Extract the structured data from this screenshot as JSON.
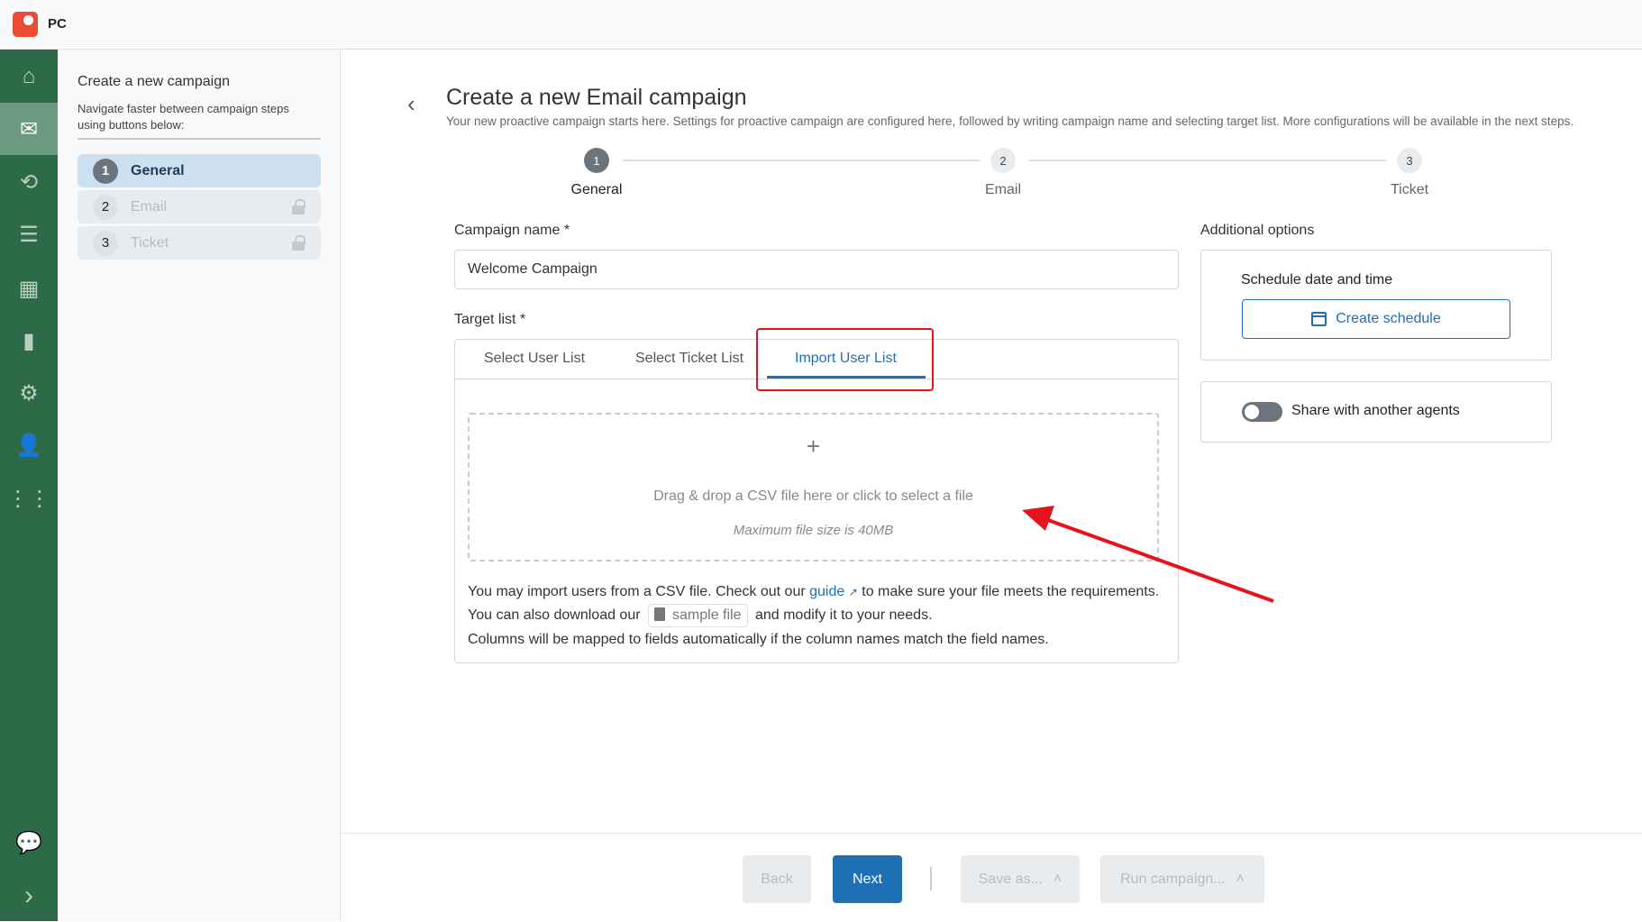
{
  "app": {
    "title": "PC"
  },
  "nav": {
    "items": [
      "home",
      "email",
      "integrations",
      "inbox",
      "widgets",
      "reports",
      "settings",
      "agents",
      "apps"
    ],
    "bottom": [
      "chat",
      "expand"
    ],
    "active": "email"
  },
  "panel": {
    "title": "Create a new campaign",
    "description": "Navigate faster between campaign steps using buttons below:",
    "steps": [
      {
        "num": "1",
        "label": "General",
        "active": true,
        "locked": false
      },
      {
        "num": "2",
        "label": "Email",
        "locked": true
      },
      {
        "num": "3",
        "label": "Ticket",
        "locked": true
      }
    ]
  },
  "page": {
    "title": "Create a new Email campaign",
    "description": "Your new proactive campaign starts here. Settings for proactive campaign are configured here, followed by writing campaign name and selecting target list. More configurations will be available in the next steps."
  },
  "stepper": [
    {
      "num": "1",
      "label": "General"
    },
    {
      "num": "2",
      "label": "Email"
    },
    {
      "num": "3",
      "label": "Ticket"
    }
  ],
  "form": {
    "campaign_name_label": "Campaign name *",
    "campaign_name_value": "Welcome Campaign",
    "target_list_label": "Target list *",
    "tabs": [
      "Select User List",
      "Select Ticket List",
      "Import User List"
    ],
    "active_tab": "Import User List",
    "dropzone": {
      "plus": "+",
      "text": "Drag & drop a CSV file here or click to select a file",
      "max": "Maximum file size is 40MB"
    },
    "info": {
      "l1a": "You may import users from a CSV file. Check out our",
      "guide": "guide",
      "l1b": "to make sure your file meets the requirements.",
      "l2a": "You can also download our",
      "sample": "sample file",
      "l2b": "and modify it to your needs.",
      "l3": "Columns will be mapped to fields automatically if the column names match the field names."
    }
  },
  "options": {
    "label": "Additional options",
    "schedule_label": "Schedule date and time",
    "schedule_button": "Create schedule",
    "share_label": "Share with another agents",
    "share_enabled": false
  },
  "footer": {
    "back": "Back",
    "next": "Next",
    "save": "Save as...",
    "run": "Run campaign..."
  },
  "annotation_color": "#e8121b"
}
